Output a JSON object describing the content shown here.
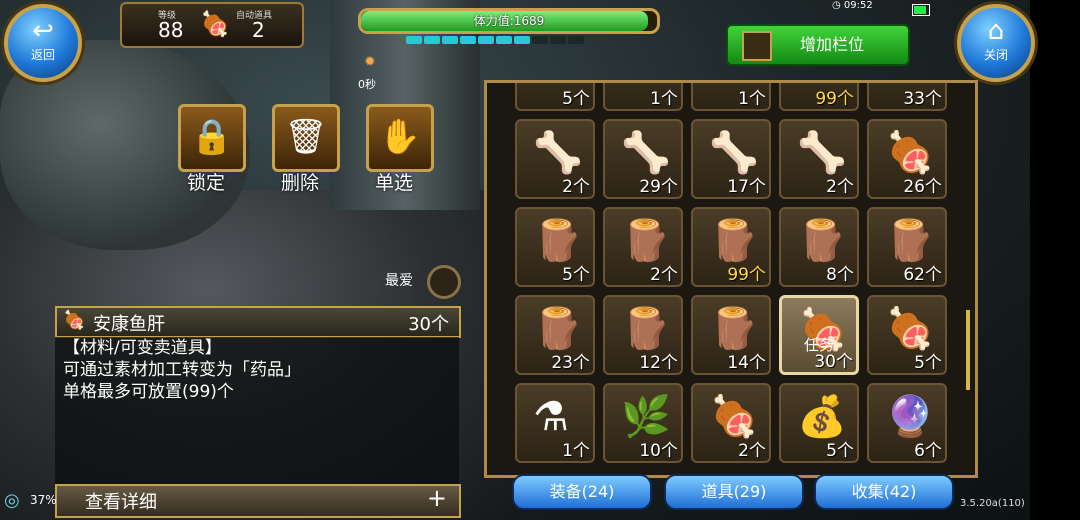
{
  "nav": {
    "back_label": "返回",
    "close_label": "关闭"
  },
  "player": {
    "level_label": "等级",
    "level": "88",
    "auto_item_label": "自动道具",
    "auto_item_count": "2"
  },
  "stamina": {
    "label": "体力值:1689",
    "fill_fraction": 0.97,
    "energy_segments_filled": 7,
    "energy_segments_total": 10
  },
  "timer": "0秒",
  "status_bar": {
    "time": "09:52"
  },
  "add_slot": {
    "label": "增加栏位"
  },
  "actions": [
    {
      "label": "锁定",
      "icon": "lock-icon"
    },
    {
      "label": "删除",
      "icon": "trash-icon"
    },
    {
      "label": "单选",
      "icon": "hand-select-icon"
    }
  ],
  "favorite": {
    "label": "最爱"
  },
  "detail": {
    "name": "安康鱼肝",
    "count": "30个",
    "lines": [
      "【材料/可变卖道具】",
      "可通过素材加工转变为「药品」",
      "单格最多可放置(99)个"
    ],
    "view_details": "查看详细",
    "plus": "+"
  },
  "battery_percent": "37%",
  "version": "3.5.20a(110)",
  "inventory": {
    "rows": [
      [
        {
          "icon": "item-icon",
          "count": "5个"
        },
        {
          "icon": "item-icon",
          "count": "1个"
        },
        {
          "icon": "item-icon",
          "count": "1个"
        },
        {
          "icon": "item-icon",
          "count": "99个",
          "highlight": true
        },
        {
          "icon": "item-icon",
          "count": "33个"
        }
      ],
      [
        {
          "icon": "claw-icon",
          "count": "2个"
        },
        {
          "icon": "claw-icon",
          "count": "29个"
        },
        {
          "icon": "claw-icon",
          "count": "17个"
        },
        {
          "icon": "claw-icon",
          "count": "2个"
        },
        {
          "icon": "fish-liver-icon",
          "count": "26个"
        }
      ],
      [
        {
          "icon": "wood-sprout-icon",
          "count": "5个"
        },
        {
          "icon": "wood-sprout-icon",
          "count": "2个"
        },
        {
          "icon": "wood-sprout-icon",
          "count": "99个",
          "highlight": true
        },
        {
          "icon": "wood-sprout-icon",
          "count": "8个"
        },
        {
          "icon": "wood-sprout-icon",
          "count": "62个"
        }
      ],
      [
        {
          "icon": "wood-sprout-icon",
          "count": "23个"
        },
        {
          "icon": "wood-sprout-icon",
          "count": "12个"
        },
        {
          "icon": "wood-sprout-icon",
          "count": "14个"
        },
        {
          "icon": "fish-liver-icon",
          "count": "30个",
          "selected": true,
          "tag": "任务"
        },
        {
          "icon": "fish-liver-icon",
          "count": "5个"
        }
      ],
      [
        {
          "icon": "potion-icon",
          "count": "1个"
        },
        {
          "icon": "herb-plant-icon",
          "count": "10个"
        },
        {
          "icon": "fish-liver-icon",
          "count": "2个"
        },
        {
          "icon": "pouch-icon",
          "count": "5个"
        },
        {
          "icon": "orb-icon",
          "count": "6个"
        }
      ]
    ]
  },
  "tabs": [
    {
      "label": "装备(24)"
    },
    {
      "label": "道具(29)"
    },
    {
      "label": "收集(42)"
    }
  ],
  "colors": {
    "accent_gold": "#c7a24c",
    "stamina_green": "#1f9a22",
    "tab_blue": "#1f6fd6",
    "highlight_count": "#ffd84a"
  }
}
